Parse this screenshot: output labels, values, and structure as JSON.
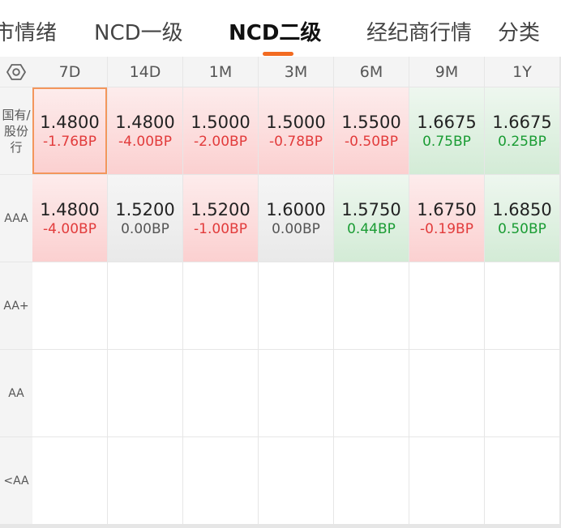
{
  "tabs": [
    {
      "label": "市情绪",
      "active": false
    },
    {
      "label": "NCD一级",
      "active": false
    },
    {
      "label": "NCD二级",
      "active": true
    },
    {
      "label": "经纪商行情",
      "active": false
    },
    {
      "label": "分类",
      "active": false
    }
  ],
  "table": {
    "settings_icon": "hexagon-settings-icon",
    "columns": [
      "7D",
      "14D",
      "1M",
      "3M",
      "6M",
      "9M",
      "1Y"
    ],
    "rows": [
      {
        "label": "国有/股份行",
        "cells": [
          {
            "value": "1.4800",
            "change": "-1.76BP",
            "trend": "red",
            "selected": true
          },
          {
            "value": "1.4800",
            "change": "-4.00BP",
            "trend": "red"
          },
          {
            "value": "1.5000",
            "change": "-2.00BP",
            "trend": "red"
          },
          {
            "value": "1.5000",
            "change": "-0.78BP",
            "trend": "red"
          },
          {
            "value": "1.5500",
            "change": "-0.50BP",
            "trend": "red"
          },
          {
            "value": "1.6675",
            "change": "0.75BP",
            "trend": "green"
          },
          {
            "value": "1.6675",
            "change": "0.25BP",
            "trend": "green"
          }
        ]
      },
      {
        "label": "AAA",
        "cells": [
          {
            "value": "1.4800",
            "change": "-4.00BP",
            "trend": "red"
          },
          {
            "value": "1.5200",
            "change": "0.00BP",
            "trend": "gray"
          },
          {
            "value": "1.5200",
            "change": "-1.00BP",
            "trend": "red"
          },
          {
            "value": "1.6000",
            "change": "0.00BP",
            "trend": "gray"
          },
          {
            "value": "1.5750",
            "change": "0.44BP",
            "trend": "green"
          },
          {
            "value": "1.6750",
            "change": "-0.19BP",
            "trend": "red"
          },
          {
            "value": "1.6850",
            "change": "0.50BP",
            "trend": "green"
          }
        ]
      },
      {
        "label": "AA+",
        "cells": []
      },
      {
        "label": "AA",
        "cells": []
      },
      {
        "label": "<AA",
        "cells": []
      }
    ]
  },
  "colors": {
    "accent": "#f26b21",
    "up_red": "#e23b3b",
    "down_green": "#1a9c34"
  }
}
